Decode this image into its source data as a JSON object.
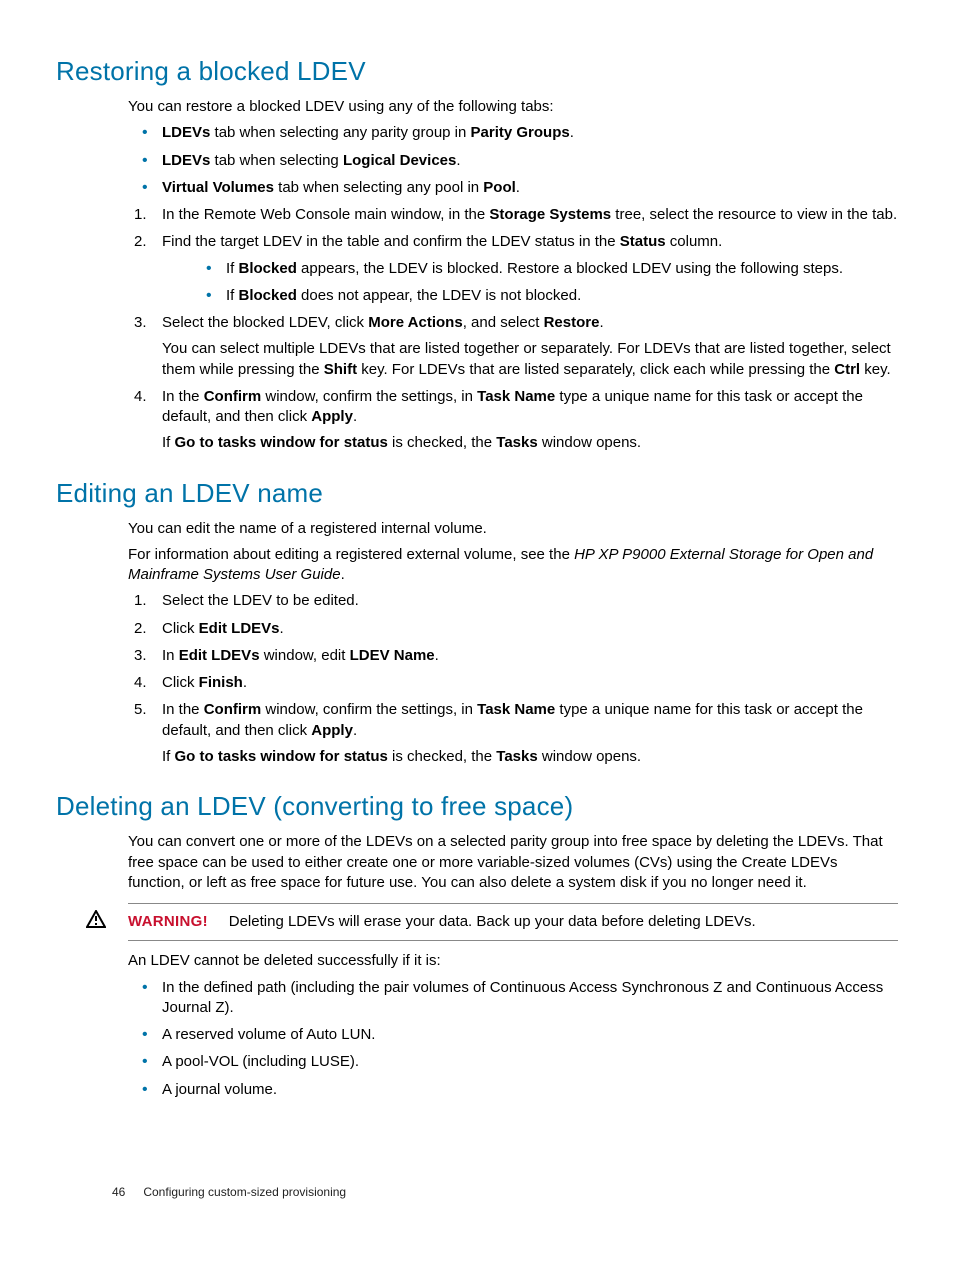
{
  "section1": {
    "heading": "Restoring a blocked LDEV",
    "intro": "You can restore a blocked LDEV using any of the following tabs:",
    "bullets": [
      {
        "pre": "",
        "b1": "LDEVs",
        "mid": " tab when selecting any parity group in ",
        "b2": "Parity Groups",
        "post": "."
      },
      {
        "pre": "",
        "b1": "LDEVs",
        "mid": " tab when selecting ",
        "b2": "Logical Devices",
        "post": "."
      },
      {
        "pre": "",
        "b1": "Virtual Volumes",
        "mid": " tab when selecting any pool in ",
        "b2": "Pool",
        "post": "."
      }
    ],
    "steps": {
      "s1": {
        "pre": "In the Remote Web Console main window, in the ",
        "b1": "Storage Systems",
        "post": " tree, select the resource to view in the tab."
      },
      "s2": {
        "pre": "Find the target LDEV in the table and confirm the LDEV status in the ",
        "b1": "Status",
        "post": " column.",
        "sub1": {
          "pre": "If ",
          "b1": "Blocked",
          "post": " appears, the LDEV is blocked. Restore a blocked LDEV using the following steps."
        },
        "sub2": {
          "pre": "If ",
          "b1": "Blocked",
          "post": " does not appear, the LDEV is not blocked."
        }
      },
      "s3": {
        "pre": "Select the blocked LDEV, click ",
        "b1": "More Actions",
        "mid": ", and select ",
        "b2": "Restore",
        "post": ".",
        "cont": {
          "pre": "You can select multiple LDEVs that are listed together or separately. For LDEVs that are listed together, select them while pressing the ",
          "b1": "Shift",
          "mid": " key. For LDEVs that are listed separately, click each while pressing the ",
          "b2": "Ctrl",
          "post": " key."
        }
      },
      "s4": {
        "pre": "In the ",
        "b1": "Confirm",
        "mid1": " window, confirm the settings, in ",
        "b2": "Task Name",
        "mid2": " type a unique name for this task or accept the default, and then click ",
        "b3": "Apply",
        "post": ".",
        "cont": {
          "pre": "If ",
          "b1": "Go to tasks window for status",
          "mid": " is checked, the ",
          "b2": "Tasks",
          "post": " window opens."
        }
      }
    }
  },
  "section2": {
    "heading": "Editing an LDEV name",
    "p1": "You can edit the name of a registered internal volume.",
    "p2": {
      "pre": "For information about editing a registered external volume, see the ",
      "i1": "HP XP P9000 External Storage for Open and Mainframe Systems User Guide",
      "post": "."
    },
    "steps": {
      "s1": "Select the LDEV to be edited.",
      "s2": {
        "pre": "Click ",
        "b1": "Edit LDEVs",
        "post": "."
      },
      "s3": {
        "pre": "In ",
        "b1": "Edit LDEVs",
        "mid": " window, edit ",
        "b2": "LDEV Name",
        "post": "."
      },
      "s4": {
        "pre": "Click ",
        "b1": "Finish",
        "post": "."
      },
      "s5": {
        "pre": "In the ",
        "b1": "Confirm",
        "mid1": " window, confirm the settings, in ",
        "b2": "Task Name",
        "mid2": " type a unique name for this task or accept the default, and then click ",
        "b3": "Apply",
        "post": ".",
        "cont": {
          "pre": "If ",
          "b1": "Go to tasks window for status",
          "mid": " is checked, the ",
          "b2": "Tasks",
          "post": " window opens."
        }
      }
    }
  },
  "section3": {
    "heading": "Deleting an LDEV (converting to free space)",
    "p1": "You can convert one or more of the LDEVs on a selected parity group into free space by deleting the LDEVs. That free space can be used to either create one or more variable-sized volumes (CVs) using the Create LDEVs function, or left as free space for future use. You can also delete a system disk if you no longer need it.",
    "warning": {
      "label": "WARNING!",
      "text": "Deleting LDEVs will erase your data. Back up your data before deleting LDEVs."
    },
    "p2": "An LDEV cannot be deleted successfully if it is:",
    "bullets": [
      "In the defined path (including the pair volumes of Continuous Access Synchronous Z and Continuous Access Journal Z).",
      "A reserved volume of Auto LUN.",
      "A pool-VOL (including LUSE).",
      "A journal volume."
    ]
  },
  "footer": {
    "page": "46",
    "title": "Configuring custom-sized provisioning"
  }
}
